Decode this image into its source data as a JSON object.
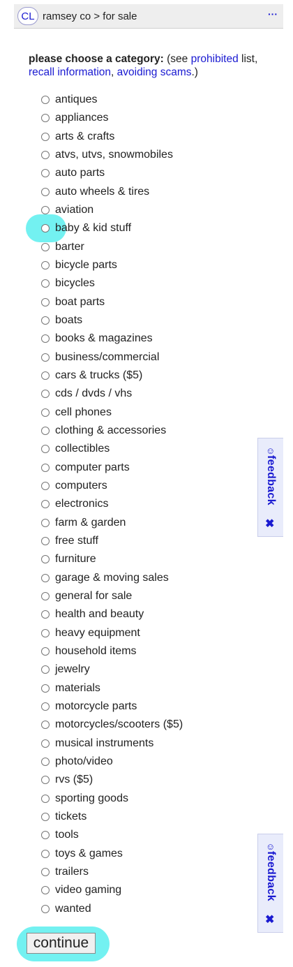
{
  "header": {
    "logo_text": "CL",
    "breadcrumb": "ramsey co > for sale",
    "menu": "···"
  },
  "heading": {
    "bold": "please choose a category:",
    "see": " (see ",
    "prohibited": "prohibited",
    "list": " list,",
    "recall": "recall information",
    "comma": ", ",
    "scams": "avoiding scams",
    "end": ".)"
  },
  "categories": [
    "antiques",
    "appliances",
    "arts & crafts",
    "atvs, utvs, snowmobiles",
    "auto parts",
    "auto wheels & tires",
    "aviation",
    "baby & kid stuff",
    "barter",
    "bicycle parts",
    "bicycles",
    "boat parts",
    "boats",
    "books & magazines",
    "business/commercial",
    "cars & trucks ($5)",
    "cds / dvds / vhs",
    "cell phones",
    "clothing & accessories",
    "collectibles",
    "computer parts",
    "computers",
    "electronics",
    "farm & garden",
    "free stuff",
    "furniture",
    "garage & moving sales",
    "general for sale",
    "health and beauty",
    "heavy equipment",
    "household items",
    "jewelry",
    "materials",
    "motorcycle parts",
    "motorcycles/scooters ($5)",
    "musical instruments",
    "photo/video",
    "rvs ($5)",
    "sporting goods",
    "tickets",
    "tools",
    "toys & games",
    "trailers",
    "video gaming",
    "wanted"
  ],
  "feedback": {
    "smiley": "☺",
    "label": "feedback",
    "close": "✖"
  },
  "continue_label": "continue",
  "colors": {
    "link": "#1a1ad1",
    "highlight": "#00e6e6"
  }
}
